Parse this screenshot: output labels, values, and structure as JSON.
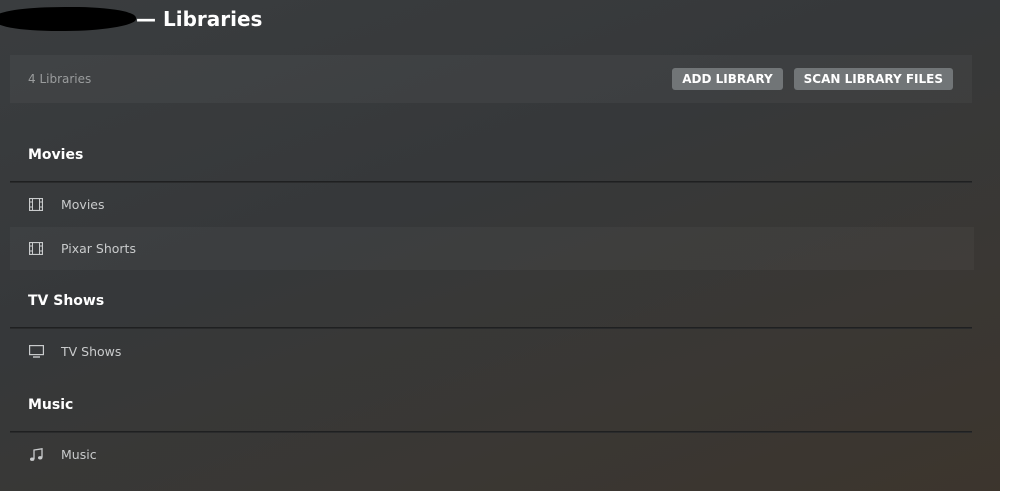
{
  "header": {
    "title": "— Libraries"
  },
  "toolbar": {
    "count_text": "4 Libraries",
    "add_label": "ADD LIBRARY",
    "scan_label": "SCAN LIBRARY FILES"
  },
  "sections": [
    {
      "title": "Movies",
      "items": [
        {
          "label": "Movies",
          "icon": "film-icon"
        },
        {
          "label": "Pixar Shorts",
          "icon": "film-icon"
        }
      ]
    },
    {
      "title": "TV Shows",
      "items": [
        {
          "label": "TV Shows",
          "icon": "monitor-icon"
        }
      ]
    },
    {
      "title": "Music",
      "items": [
        {
          "label": "Music",
          "icon": "music-note-icon"
        }
      ]
    }
  ]
}
